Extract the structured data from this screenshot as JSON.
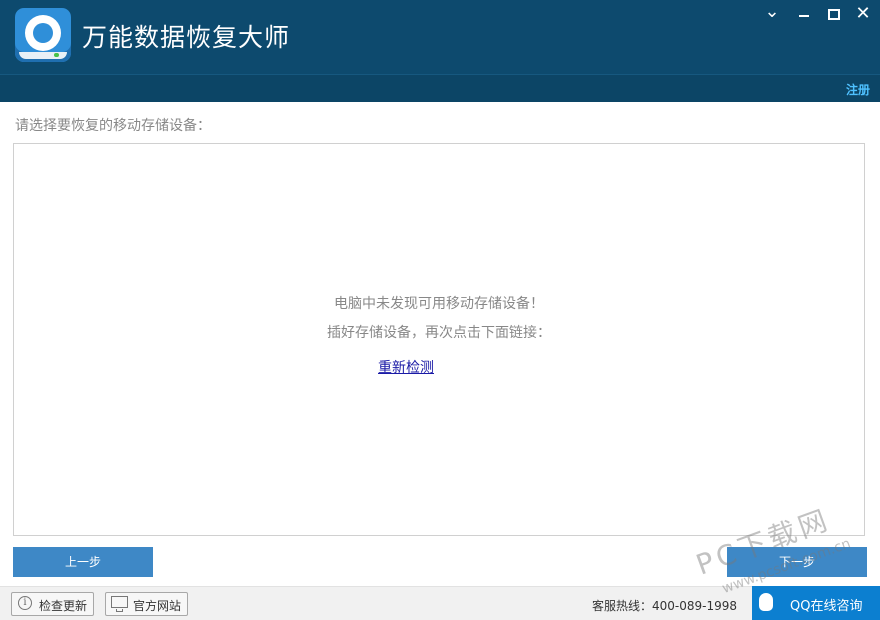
{
  "window": {
    "title": "万能数据恢复大师",
    "controls": [
      "collapse",
      "minimize",
      "maximize",
      "close"
    ]
  },
  "header": {
    "register_label": "注册"
  },
  "main": {
    "prompt": "请选择要恢复的移动存储设备：",
    "empty_message_line1": "电脑中未发现可用移动存储设备！",
    "empty_message_line2": "插好存储设备，再次点击下面链接：",
    "redetect_link": "重新检测"
  },
  "nav": {
    "prev_label": "上一步",
    "next_label": "下一步"
  },
  "footer": {
    "check_update_label": "检查更新",
    "official_site_label": "官方网站",
    "hotline": "客服热线：400-089-1998",
    "qq_label": "QQ在线咨询"
  },
  "watermark": {
    "main": "PC下载网",
    "sub": "www.pcsoft.com.cn"
  },
  "colors": {
    "titlebar": "#0d4a6e",
    "accent": "#3e88c6",
    "qq": "#0c7fd0",
    "register": "#4fc1ff"
  },
  "icons": [
    "app-logo-icon",
    "chevron-down-icon",
    "minimize-icon",
    "maximize-icon",
    "close-icon",
    "info-icon",
    "monitor-icon",
    "qq-penguin-icon"
  ]
}
